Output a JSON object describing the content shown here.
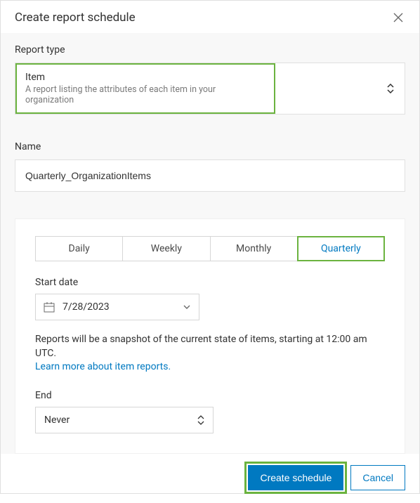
{
  "header": {
    "title": "Create report schedule"
  },
  "reportType": {
    "label": "Report type",
    "selectedTitle": "Item",
    "selectedDesc": "A report listing the attributes of each item in your organization"
  },
  "name": {
    "label": "Name",
    "value": "Quarterly_OrganizationItems"
  },
  "frequency": {
    "tabs": [
      "Daily",
      "Weekly",
      "Monthly",
      "Quarterly"
    ],
    "active": "Quarterly"
  },
  "startDate": {
    "label": "Start date",
    "value": "7/28/2023"
  },
  "info": {
    "text": "Reports will be a snapshot of the current state of items, starting at 12:00 am UTC.",
    "linkText": "Learn more about item reports."
  },
  "end": {
    "label": "End",
    "value": "Never"
  },
  "footer": {
    "primary": "Create schedule",
    "cancel": "Cancel"
  }
}
